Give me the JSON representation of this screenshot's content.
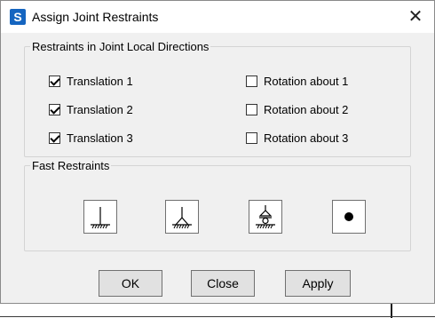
{
  "window": {
    "title": "Assign Joint Restraints",
    "app_icon_letter": "S",
    "close_glyph": "✕"
  },
  "restraints": {
    "legend": "Restraints in Joint Local Directions",
    "translations": [
      {
        "label": "Translation 1",
        "checked": true
      },
      {
        "label": "Translation 2",
        "checked": true
      },
      {
        "label": "Translation 3",
        "checked": true
      }
    ],
    "rotations": [
      {
        "label": "Rotation about 1",
        "checked": false
      },
      {
        "label": "Rotation about 2",
        "checked": false
      },
      {
        "label": "Rotation about 3",
        "checked": false
      }
    ]
  },
  "fast_restraints": {
    "legend": "Fast Restraints",
    "buttons": [
      "fixed-support-icon",
      "pinned-support-icon",
      "roller-support-icon",
      "free-joint-icon"
    ]
  },
  "buttons": {
    "ok": "OK",
    "close": "Close",
    "apply": "Apply"
  }
}
